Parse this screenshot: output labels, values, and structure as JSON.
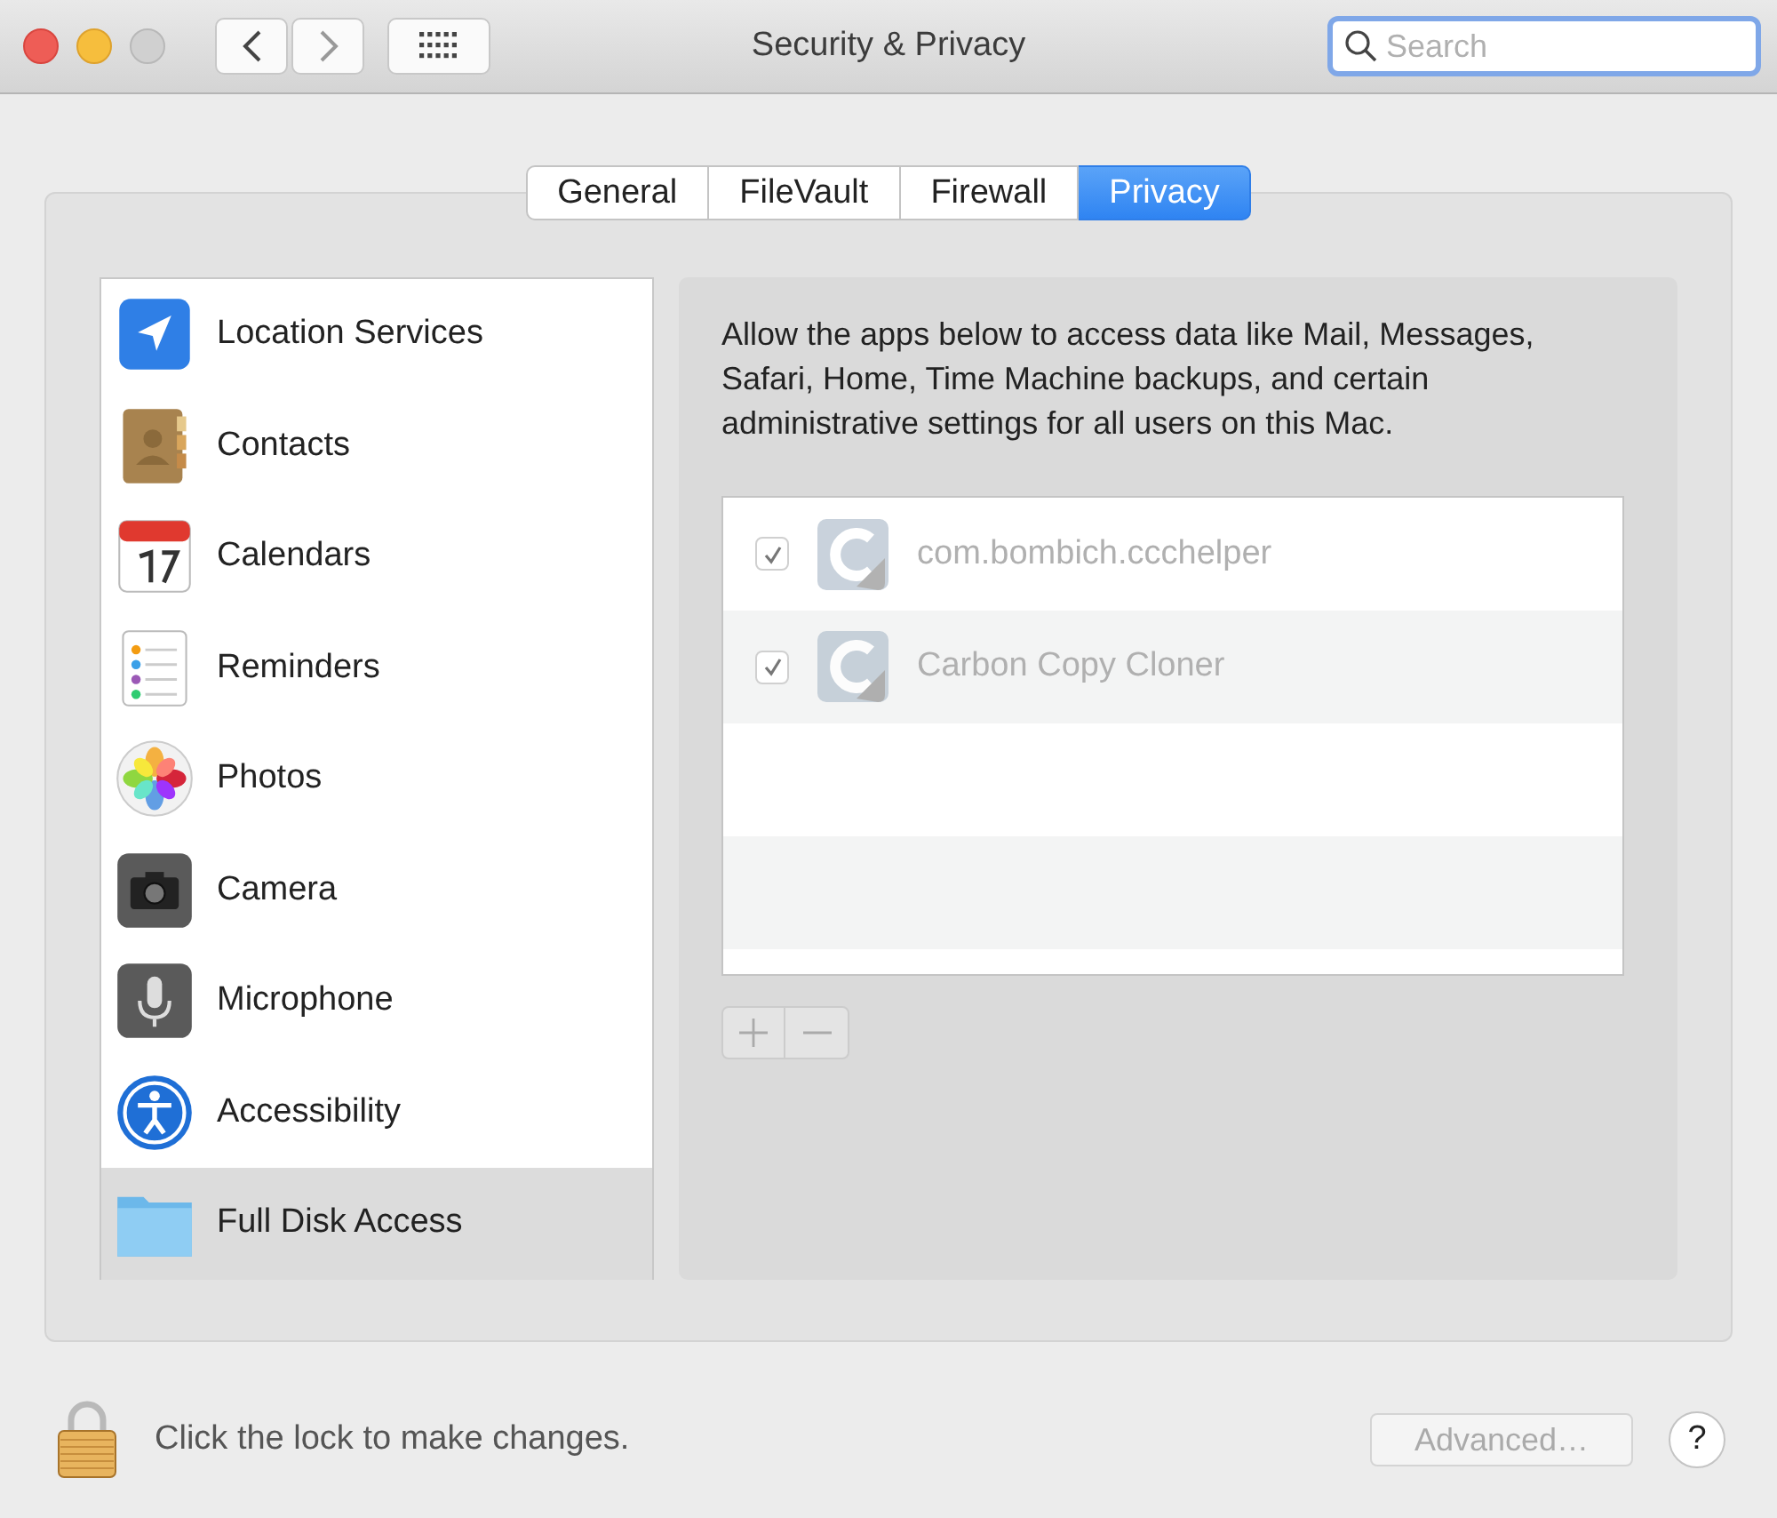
{
  "window": {
    "title": "Security & Privacy"
  },
  "search": {
    "placeholder": "Search"
  },
  "tabs": [
    {
      "label": "General",
      "selected": false
    },
    {
      "label": "FileVault",
      "selected": false
    },
    {
      "label": "Firewall",
      "selected": false
    },
    {
      "label": "Privacy",
      "selected": true
    }
  ],
  "sidebar": {
    "items": [
      {
        "label": "Location Services",
        "kind": "location",
        "selected": false
      },
      {
        "label": "Contacts",
        "kind": "contacts",
        "selected": false
      },
      {
        "label": "Calendars",
        "kind": "calendar",
        "selected": false
      },
      {
        "label": "Reminders",
        "kind": "reminders",
        "selected": false
      },
      {
        "label": "Photos",
        "kind": "photos",
        "selected": false
      },
      {
        "label": "Camera",
        "kind": "camera",
        "selected": false
      },
      {
        "label": "Microphone",
        "kind": "microphone",
        "selected": false
      },
      {
        "label": "Accessibility",
        "kind": "accessibility",
        "selected": false
      },
      {
        "label": "Full Disk Access",
        "kind": "folder",
        "selected": true
      }
    ]
  },
  "description": "Allow the apps below to access data like Mail, Messages, Safari, Home, Time Machine backups, and certain administrative settings for all users on this Mac.",
  "apps": [
    {
      "name": "com.bombich.ccchelper",
      "checked": true,
      "disabled": true
    },
    {
      "name": "Carbon Copy Cloner",
      "checked": true,
      "disabled": true
    }
  ],
  "list_buttons": {
    "disabled": true
  },
  "footer": {
    "lock_message": "Click the lock to make changes.",
    "advanced_button": {
      "label": "Advanced…",
      "disabled": true
    },
    "help_button": "?"
  }
}
